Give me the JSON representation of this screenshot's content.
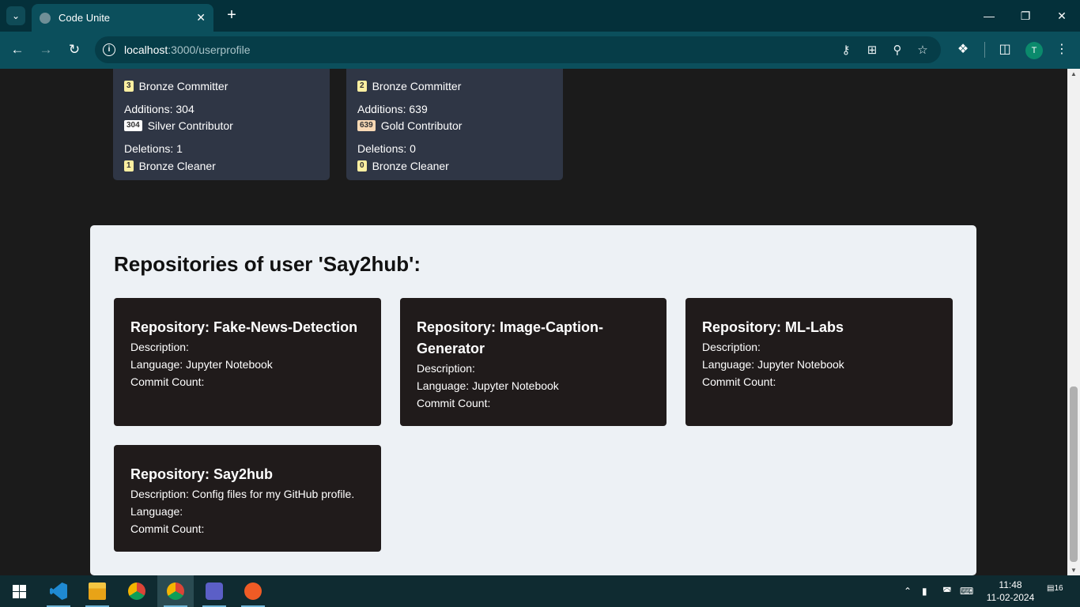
{
  "browser": {
    "tab_title": "Code Unite",
    "url_host": "localhost",
    "url_path": ":3000/userprofile",
    "profile_initial": "T"
  },
  "stat_cards": [
    {
      "commits_badge": "3",
      "commits_label": "Bronze Committer",
      "additions_text": "Additions: 304",
      "additions_badge": "304",
      "additions_label": "Silver Contributor",
      "deletions_text": "Deletions: 1",
      "deletions_badge": "1",
      "deletions_label": "Bronze Cleaner"
    },
    {
      "commits_badge": "2",
      "commits_label": "Bronze Committer",
      "additions_text": "Additions: 639",
      "additions_badge": "639",
      "additions_label": "Gold Contributor",
      "deletions_text": "Deletions: 0",
      "deletions_badge": "0",
      "deletions_label": "Bronze Cleaner"
    }
  ],
  "repo_section": {
    "heading": "Repositories of user 'Say2hub':",
    "repos": [
      {
        "title": "Repository: Fake-News-Detection",
        "description": "Description:",
        "language": "Language: Jupyter Notebook",
        "commit_count": "Commit Count:"
      },
      {
        "title": "Repository: Image-Caption-Generator",
        "description": "Description:",
        "language": "Language: Jupyter Notebook",
        "commit_count": "Commit Count:"
      },
      {
        "title": "Repository: ML-Labs",
        "description": "Description:",
        "language": "Language: Jupyter Notebook",
        "commit_count": "Commit Count:"
      },
      {
        "title": "Repository: Say2hub",
        "description": "Description: Config files for my GitHub profile.",
        "language": "Language:",
        "commit_count": "Commit Count:"
      }
    ]
  },
  "taskbar": {
    "time": "11:48",
    "date": "11-02-2024",
    "notification_count": "16",
    "apps": [
      "vscode-icon",
      "file-explorer-icon",
      "chrome-icon",
      "chrome-profile-icon",
      "teams-icon",
      "postman-icon"
    ]
  },
  "colors": {
    "tab_bar": "#04303a",
    "toolbar": "#0b4f5c",
    "page_bg": "#1b1b1b",
    "stat_card": "#2f3645",
    "repo_section": "#edf1f5",
    "repo_card": "#201b1b"
  }
}
